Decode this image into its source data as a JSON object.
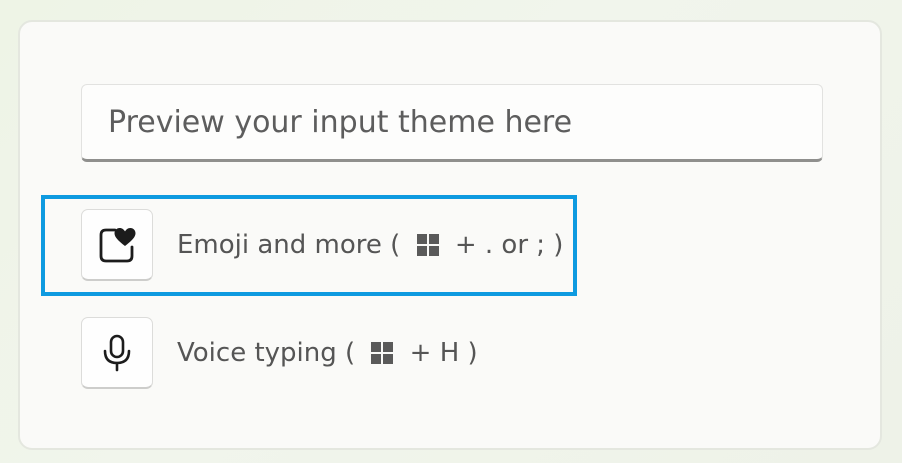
{
  "preview": {
    "placeholder": "Preview your input theme here"
  },
  "options": [
    {
      "label_before": "Emoji and more ( ",
      "label_after": " + . or ; )",
      "icon": "emoji-heart-icon",
      "focused": true
    },
    {
      "label_before": "Voice typing ( ",
      "label_after": " + H )",
      "icon": "microphone-icon",
      "focused": false
    }
  ],
  "shortcut_key_icon": "windows-key-icon",
  "colors": {
    "focus_ring": "#0e9ae0",
    "card_background": "#fafaf8",
    "label_text": "#555555"
  }
}
